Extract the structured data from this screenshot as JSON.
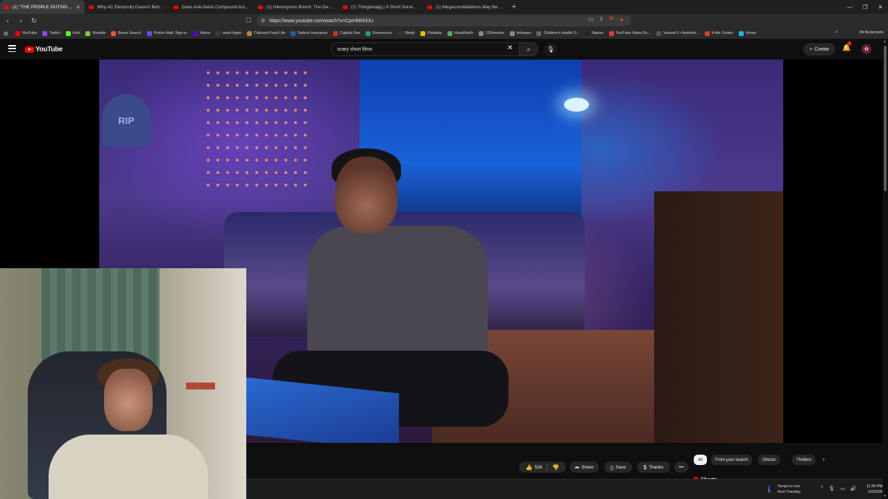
{
  "browser": {
    "tabs": [
      {
        "title": "(1) \"THE PEOPLE OUTSIDE\" |"
      },
      {
        "title": "Why AC Electricity Doesn't Behave"
      },
      {
        "title": "Does Anti-Seize Compound Actually"
      },
      {
        "title": "(1) Hieronymus Bosch: The Devil Ma"
      },
      {
        "title": "(1) Thingamajig | A Short Surreal Ho"
      },
      {
        "title": "(1) Megaconstellations May Be Just"
      }
    ],
    "new_tab": "+",
    "url": "https://www.youtube.com/watch?v=Cpmfi4hhfJU",
    "bookmarks": [
      {
        "label": "YouTube",
        "color": "#ff0000"
      },
      {
        "label": "Twitch",
        "color": "#9146ff"
      },
      {
        "label": "Kick",
        "color": "#53fc18"
      },
      {
        "label": "Rumble",
        "color": "#85c742"
      },
      {
        "label": "Brave Search",
        "color": "#fb542b"
      },
      {
        "label": "Proton Mail: Sign-in",
        "color": "#6d4aff"
      },
      {
        "label": "Yahoo",
        "color": "#6001d2"
      },
      {
        "label": "word hippo",
        "color": "#3a3a3a"
      },
      {
        "label": "Cultured Food Life",
        "color": "#c08040"
      },
      {
        "label": "Safeco Insurance",
        "color": "#1a5fb4"
      },
      {
        "label": "Capital One",
        "color": "#d22e1e"
      },
      {
        "label": "Eversource",
        "color": "#2d9d5e"
      },
      {
        "label": "Xfinity",
        "color": "#333333"
      },
      {
        "label": "Flixbaba",
        "color": "#e5c100"
      },
      {
        "label": "HuraWatch",
        "color": "#4caf50"
      },
      {
        "label": "123movies",
        "color": "#888888"
      },
      {
        "label": "Infowars",
        "color": "#888888"
      },
      {
        "label": "Children's Health D...",
        "color": "#666666"
      },
      {
        "label": "Nature",
        "color": "#222222"
      },
      {
        "label": "YouTube Video Do...",
        "color": "#e53935"
      },
      {
        "label": "Vaxxed 3 • Authoriz...",
        "color": "#555555"
      },
      {
        "label": "Knife Center",
        "color": "#d84315"
      },
      {
        "label": "Vimeo",
        "color": "#1ab7ea"
      }
    ],
    "all_bookmarks": "All Bookmarks"
  },
  "youtube": {
    "logo_text": "YouTube",
    "search_value": "scary short films",
    "create_label": "Create",
    "notification_count": "1",
    "frame_text": "RIP",
    "actions": {
      "likes": "526",
      "share": "Share",
      "save": "Save",
      "thanks": "Thanks",
      "more": "•••"
    },
    "chips": [
      "All",
      "From your search",
      "Ghosts",
      "Thrillers"
    ],
    "shorts_heading": "Shorts"
  },
  "taskbar": {
    "weather_title": "Temps to rise",
    "weather_sub": "Next Tuesday",
    "time": "11:26 PM",
    "date": "1/2/2026"
  }
}
